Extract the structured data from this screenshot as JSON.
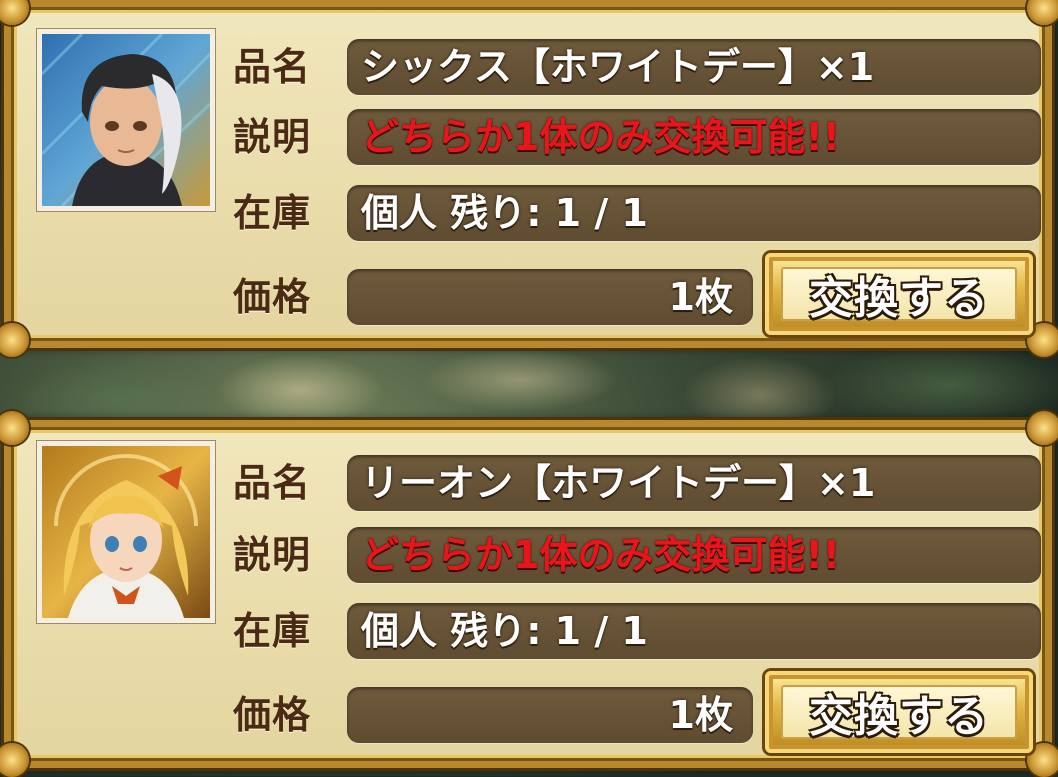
{
  "labels": {
    "name": "品名",
    "description": "説明",
    "stock": "在庫",
    "price": "価格"
  },
  "items": [
    {
      "name": "シックス【ホワイトデー】×1",
      "description": "どちらか1体のみ交換可能!!",
      "stock": "個人 残り: 1 / 1",
      "price": "1枚",
      "button": "交換する",
      "portrait_icon": "character-portrait-dark-haired-boy"
    },
    {
      "name": "リーオン【ホワイトデー】×1",
      "description": "どちらか1体のみ交換可能!!",
      "stock": "個人 残り: 1 / 1",
      "price": "1枚",
      "button": "交換する",
      "portrait_icon": "character-portrait-blonde-girl"
    }
  ],
  "colors": {
    "label_text": "#4a2a14",
    "field_bg": "#6f5a3c",
    "description_red": "#e8161b",
    "frame_gold": "#b8892c",
    "card_bg": "#f1e7bd"
  }
}
